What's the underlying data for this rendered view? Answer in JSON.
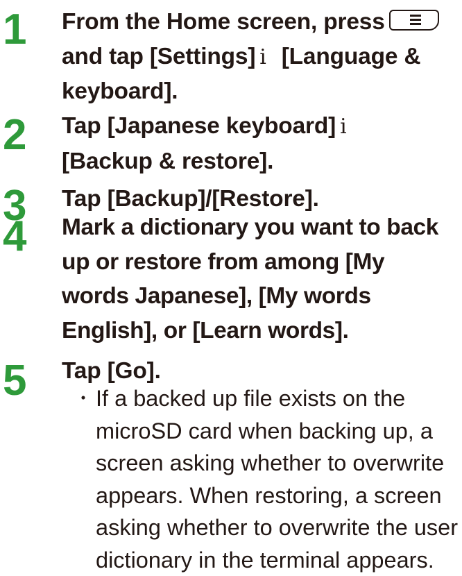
{
  "steps": [
    {
      "number": "1",
      "line1": "From the Home screen, press",
      "line2_pre": "and tap [Settings]",
      "separator": "i",
      "line2_post": "[Language &",
      "line3": "keyboard].",
      "icon": "menu-key-icon"
    },
    {
      "number": "2",
      "line1": "Tap [Japanese keyboard]",
      "separator": "i",
      "line2": "[Backup & restore]."
    },
    {
      "number": "3",
      "line1": "Tap [Backup]/[Restore]."
    },
    {
      "number": "4",
      "line1": "Mark a dictionary you want to back",
      "line2": "up or restore from among [My",
      "line3": "words Japanese], [My words",
      "line4": "English], or [Learn words]."
    },
    {
      "number": "5",
      "line1": "Tap [Go].",
      "note": {
        "bullet": "・",
        "lines": [
          "If a backed up file exists on the",
          "microSD card when backing up, a",
          "screen asking whether to overwrite",
          "appears. When restoring, a screen",
          "asking whether to overwrite the user",
          "dictionary in the terminal appears."
        ]
      }
    }
  ],
  "colors": {
    "step_number": "#2e9a3a",
    "text": "#231815",
    "background": "#ffffff"
  }
}
